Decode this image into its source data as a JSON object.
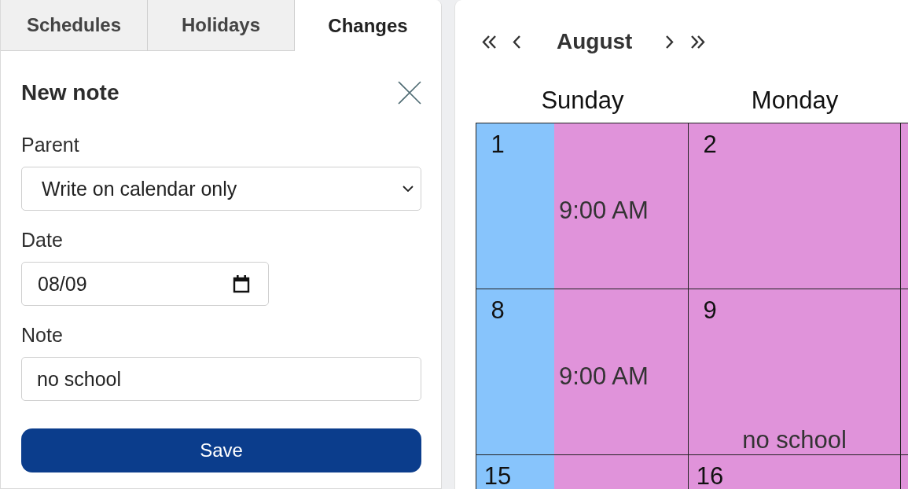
{
  "tabs": [
    {
      "label": "Schedules",
      "selected": false
    },
    {
      "label": "Holidays",
      "selected": false
    },
    {
      "label": "Changes",
      "selected": true
    }
  ],
  "form": {
    "title": "New note",
    "fields": [
      {
        "kind": "select",
        "label": "Parent",
        "value": "Write on calendar only"
      },
      {
        "kind": "date",
        "label": "Date",
        "value": "08/09"
      },
      {
        "kind": "text",
        "label": "Note",
        "value": "no school"
      }
    ],
    "submit": "Save"
  },
  "calendar": {
    "month": "August",
    "weekdays": [
      "Sunday",
      "Monday"
    ],
    "weeks": [
      [
        {
          "day": "1",
          "bands": [
            {
              "color": "#87c4fc"
            },
            {
              "color": "#e093da",
              "time": "9:00 AM"
            }
          ]
        },
        {
          "day": "2",
          "bands": [
            {
              "color": "#e093da"
            }
          ]
        },
        {
          "bands": [
            {
              "color": "#e093da"
            }
          ]
        }
      ],
      [
        {
          "day": "8",
          "bands": [
            {
              "color": "#87c4fc"
            },
            {
              "color": "#e093da",
              "time": "9:00 AM"
            }
          ]
        },
        {
          "day": "9",
          "bands": [
            {
              "color": "#e093da"
            }
          ],
          "note": "no school"
        },
        {
          "bands": [
            {
              "color": "#e093da"
            }
          ]
        }
      ],
      [
        {
          "day": "15",
          "bands": [
            {
              "color": "#87c4fc"
            },
            {
              "color": "#e093da"
            }
          ]
        },
        {
          "day": "16",
          "bands": [
            {
              "color": "#e093da"
            }
          ]
        },
        {
          "bands": [
            {
              "color": "#e093da"
            }
          ]
        }
      ]
    ]
  }
}
